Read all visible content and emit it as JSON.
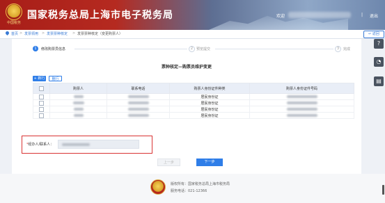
{
  "header": {
    "title": "国家税务总局上海市电子税务局",
    "logo_text": "中国税务",
    "welcome_label": "欢迎",
    "separator": "|",
    "logout_label": "退出"
  },
  "breadcrumb": {
    "items": [
      "首页",
      "发票领用",
      "发票票种核定",
      "发票票种核定（变更购票人）"
    ]
  },
  "back_label": "返回",
  "side_icons": [
    "help-icon",
    "headset-icon",
    "document-icon"
  ],
  "steps": [
    {
      "number": "1",
      "label": "修改购票员信息",
      "active": true
    },
    {
      "number": "2",
      "label": "预览提交",
      "active": false
    },
    {
      "number": "3",
      "label": "完成",
      "active": false
    }
  ],
  "section_title": "票种核定—购票员维护变更",
  "toolbar": {
    "add_label": "+ 新行",
    "delete_label": "删行"
  },
  "table": {
    "columns": [
      "",
      "购票人",
      "联系电话",
      "购票人身份证件种类",
      "购票人身份证件号码"
    ],
    "rows": [
      {
        "id_type": "居民身份证"
      },
      {
        "id_type": "居民身份证"
      },
      {
        "id_type": "居民身份证"
      },
      {
        "id_type": "居民身份证"
      }
    ]
  },
  "authorizer": {
    "label_req": "*",
    "label": "经办人/联系人："
  },
  "actions": {
    "prev_label": "上一步",
    "next_label": "下一步"
  },
  "footer": {
    "copyright": "版权所有：国家税务总局上海市税务局",
    "hotline": "服务电话：021-12366"
  },
  "colors": {
    "accent": "#2f7ee8",
    "header_red": "#a81e18",
    "highlight": "#d93232"
  }
}
